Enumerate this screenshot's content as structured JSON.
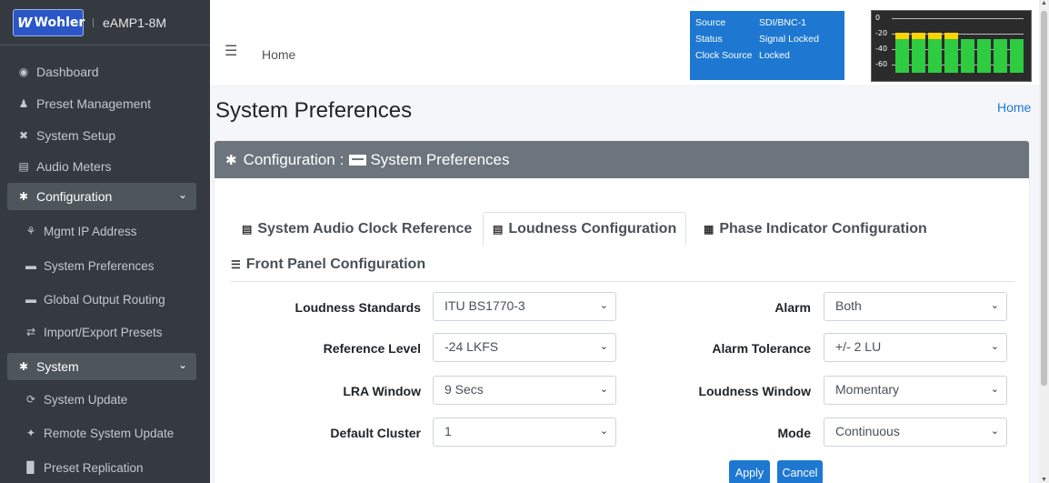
{
  "brand": {
    "logo_mark": "W",
    "logo_text": "Wohler",
    "device_name": "eAMP1-8M"
  },
  "sidebar": {
    "items": [
      {
        "label": "Dashboard",
        "icon": "tachometer-icon"
      },
      {
        "label": "Preset Management",
        "icon": "user-edit-icon"
      },
      {
        "label": "System Setup",
        "icon": "tools-icon"
      },
      {
        "label": "Audio Meters",
        "icon": "chart-bar-icon"
      },
      {
        "label": "Configuration",
        "icon": "cog-icon",
        "expanded": true
      },
      {
        "label": "Mgmt IP Address",
        "icon": "network-icon"
      },
      {
        "label": "System Preferences",
        "icon": "keyboard-icon"
      },
      {
        "label": "Global Output Routing",
        "icon": "keyboard-icon"
      },
      {
        "label": "Import/Export Presets",
        "icon": "exchange-icon"
      },
      {
        "label": "System",
        "icon": "cogs-icon",
        "expanded": true
      },
      {
        "label": "System Update",
        "icon": "sync-icon"
      },
      {
        "label": "Remote System Update",
        "icon": "broadcast-icon"
      },
      {
        "label": "Preset Replication",
        "icon": "clone-icon"
      }
    ]
  },
  "topbar": {
    "breadcrumb": "Home"
  },
  "status": {
    "source_label": "Source",
    "source_value": "SDI/BNC-1",
    "status_label": "Status",
    "status_value": "Signal Locked",
    "clock_label": "Clock Source",
    "clock_value": "Locked"
  },
  "meter": {
    "scale": [
      "0",
      "-20",
      "-40",
      "-60"
    ],
    "bars": [
      0.73,
      0.73,
      0.73,
      0.73,
      0.62,
      0.62,
      0.62,
      0.62
    ],
    "peak": [
      true,
      true,
      true,
      true,
      false,
      false,
      false,
      false
    ],
    "colors": {
      "signal": "#2ecc40",
      "peak": "#ffd400"
    }
  },
  "page": {
    "title": "System Preferences",
    "breadcrumb_home": "Home"
  },
  "card": {
    "header_section": "Configuration",
    "header_sep": ":",
    "header_page": "System Preferences"
  },
  "tabs": [
    {
      "label": "System Audio Clock Reference",
      "active": false
    },
    {
      "label": "Loudness Configuration",
      "active": true
    },
    {
      "label": "Phase Indicator Configuration",
      "active": false
    },
    {
      "label": "Front Panel Configuration",
      "active": false
    }
  ],
  "form": {
    "loudness_standards": {
      "label": "Loudness Standards",
      "value": "ITU BS1770-3"
    },
    "reference_level": {
      "label": "Reference Level",
      "value": "-24 LKFS"
    },
    "lra_window": {
      "label": "LRA Window",
      "value": "9 Secs"
    },
    "default_cluster": {
      "label": "Default Cluster",
      "value": "1"
    },
    "alarm": {
      "label": "Alarm",
      "value": "Both"
    },
    "alarm_tolerance": {
      "label": "Alarm Tolerance",
      "value": "+/- 2 LU"
    },
    "loudness_window": {
      "label": "Loudness Window",
      "value": "Momentary"
    },
    "mode": {
      "label": "Mode",
      "value": "Continuous"
    }
  },
  "buttons": {
    "apply": "Apply",
    "cancel": "Cancel"
  },
  "colors": {
    "accent": "#1e78d2",
    "sidebar_bg": "#343a40",
    "card_header": "#6c757d"
  }
}
